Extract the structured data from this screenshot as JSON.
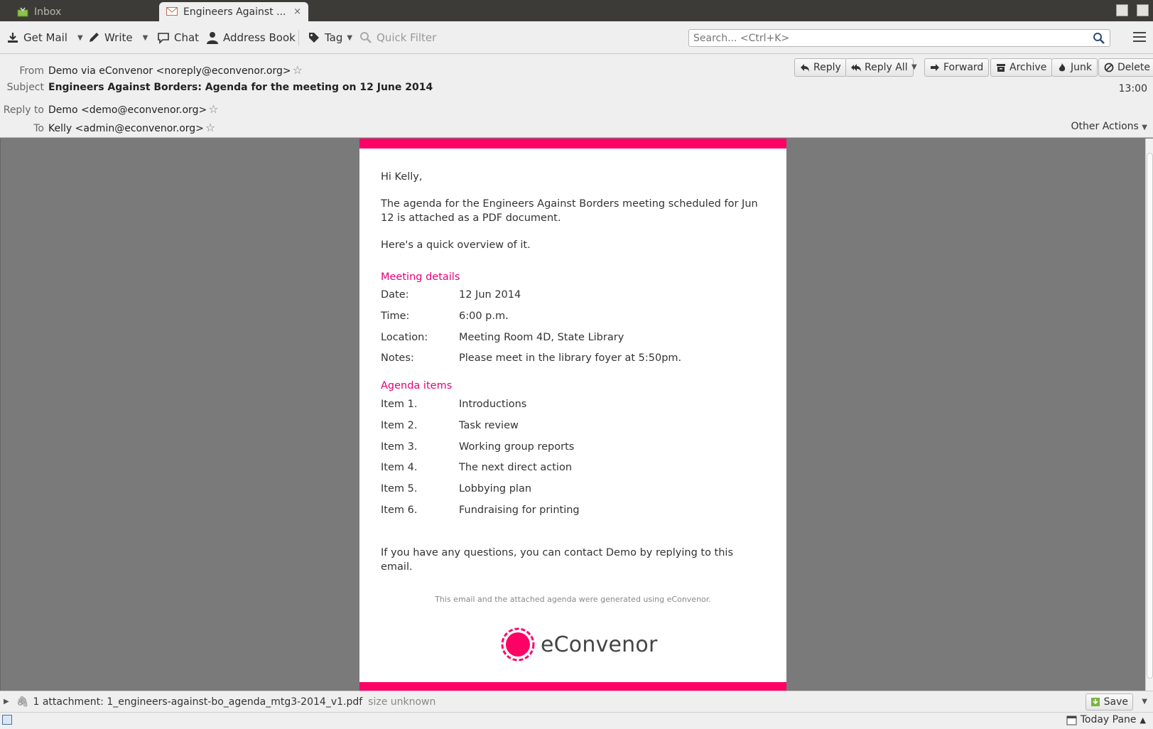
{
  "tabs": [
    {
      "label": "Inbox"
    },
    {
      "label": "Engineers Against ...",
      "close": "×"
    }
  ],
  "toolbar": {
    "get_mail": "Get Mail",
    "write": "Write",
    "chat": "Chat",
    "address_book": "Address Book",
    "tag": "Tag",
    "quick_filter": "Quick Filter",
    "search_placeholder": "Search... <Ctrl+K>"
  },
  "header": {
    "from_label": "From",
    "from_value": "Demo via eConvenor <noreply@econvenor.org>",
    "subject_label": "Subject",
    "subject_value": "Engineers Against Borders: Agenda for the meeting on 12 June 2014",
    "replyto_label": "Reply to",
    "replyto_value": "Demo <demo@econvenor.org>",
    "to_label": "To",
    "to_value": "Kelly <admin@econvenor.org>",
    "time": "13:00",
    "other_actions": "Other Actions",
    "actions": {
      "reply": "Reply",
      "reply_all": "Reply All",
      "forward": "Forward",
      "archive": "Archive",
      "junk": "Junk",
      "delete": "Delete"
    }
  },
  "email": {
    "greeting": "Hi Kelly,",
    "intro": "The agenda for the Engineers Against Borders meeting scheduled for Jun 12 is attached as a PDF document.",
    "overview": "Here's a quick overview of it.",
    "meeting_heading": "Meeting details",
    "details": [
      {
        "key": "Date:",
        "value": "12 Jun 2014"
      },
      {
        "key": "Time:",
        "value": "6:00 p.m."
      },
      {
        "key": "Location:",
        "value": "Meeting Room 4D, State Library"
      },
      {
        "key": "Notes:",
        "value": "Please meet in the library foyer at 5:50pm."
      }
    ],
    "agenda_heading": "Agenda items",
    "agenda": [
      {
        "key": "Item 1.",
        "value": "Introductions"
      },
      {
        "key": "Item 2.",
        "value": "Task review"
      },
      {
        "key": "Item 3.",
        "value": "Working group reports"
      },
      {
        "key": "Item 4.",
        "value": "The next direct action"
      },
      {
        "key": "Item 5.",
        "value": "Lobbying plan"
      },
      {
        "key": "Item 6.",
        "value": "Fundraising for printing"
      }
    ],
    "closing": "If you have any questions, you can contact Demo by replying to this email.",
    "footer_note": "This email and the attached agenda were generated using eConvenor.",
    "logo_text": "eConvenor",
    "brand_color": "#ff0066"
  },
  "attachment": {
    "text": "1 attachment: 1_engineers-against-bo_agenda_mtg3-2014_v1.pdf",
    "size": "size unknown",
    "save": "Save"
  },
  "statusbar": {
    "today_pane": "Today Pane"
  }
}
